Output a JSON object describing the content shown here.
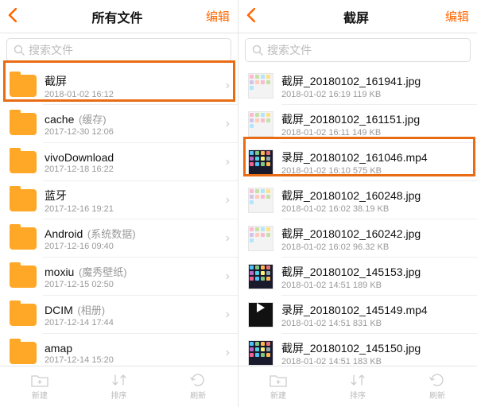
{
  "left": {
    "title": "所有文件",
    "edit": "编辑",
    "search_placeholder": "搜索文件",
    "items": [
      {
        "name": "截屏",
        "secondary": "",
        "sub": "2018-01-02 16:12"
      },
      {
        "name": "cache",
        "secondary": " (缓存)",
        "sub": "2017-12-30 12:06"
      },
      {
        "name": "vivoDownload",
        "secondary": "",
        "sub": "2017-12-18 16:22"
      },
      {
        "name": "蓝牙",
        "secondary": "",
        "sub": "2017-12-16 19:21"
      },
      {
        "name": "Android",
        "secondary": " (系统数据)",
        "sub": "2017-12-16 09:40"
      },
      {
        "name": "moxiu",
        "secondary": " (魔秀壁纸)",
        "sub": "2017-12-15 02:50"
      },
      {
        "name": "DCIM",
        "secondary": " (相册)",
        "sub": "2017-12-14 17:44"
      },
      {
        "name": "amap",
        "secondary": "",
        "sub": "2017-12-14 15:20"
      }
    ],
    "toolbar": {
      "new": "新建",
      "sort": "排序",
      "refresh": "刷新"
    }
  },
  "right": {
    "title": "截屏",
    "edit": "编辑",
    "search_placeholder": "搜索文件",
    "items": [
      {
        "name": "截屏_20180102_161941.jpg",
        "sub": "2018-01-02 16:19   119 KB",
        "thumb": "light"
      },
      {
        "name": "截屏_20180102_161151.jpg",
        "sub": "2018-01-02 16:11   149 KB",
        "thumb": "light"
      },
      {
        "name": "录屏_20180102_161046.mp4",
        "sub": "2018-01-02 16:10   575 KB",
        "thumb": "apps"
      },
      {
        "name": "截屏_20180102_160248.jpg",
        "sub": "2018-01-02 16:02   38.19 KB",
        "thumb": "light"
      },
      {
        "name": "截屏_20180102_160242.jpg",
        "sub": "2018-01-02 16:02   96.32 KB",
        "thumb": "light"
      },
      {
        "name": "截屏_20180102_145153.jpg",
        "sub": "2018-01-02 14:51   189 KB",
        "thumb": "dark"
      },
      {
        "name": "录屏_20180102_145149.mp4",
        "sub": "2018-01-02 14:51   831 KB",
        "thumb": "video"
      },
      {
        "name": "截屏_20180102_145150.jpg",
        "sub": "2018-01-02 14:51   183 KB",
        "thumb": "dark"
      }
    ],
    "toolbar": {
      "new": "新建",
      "sort": "排序",
      "refresh": "刷新"
    }
  }
}
